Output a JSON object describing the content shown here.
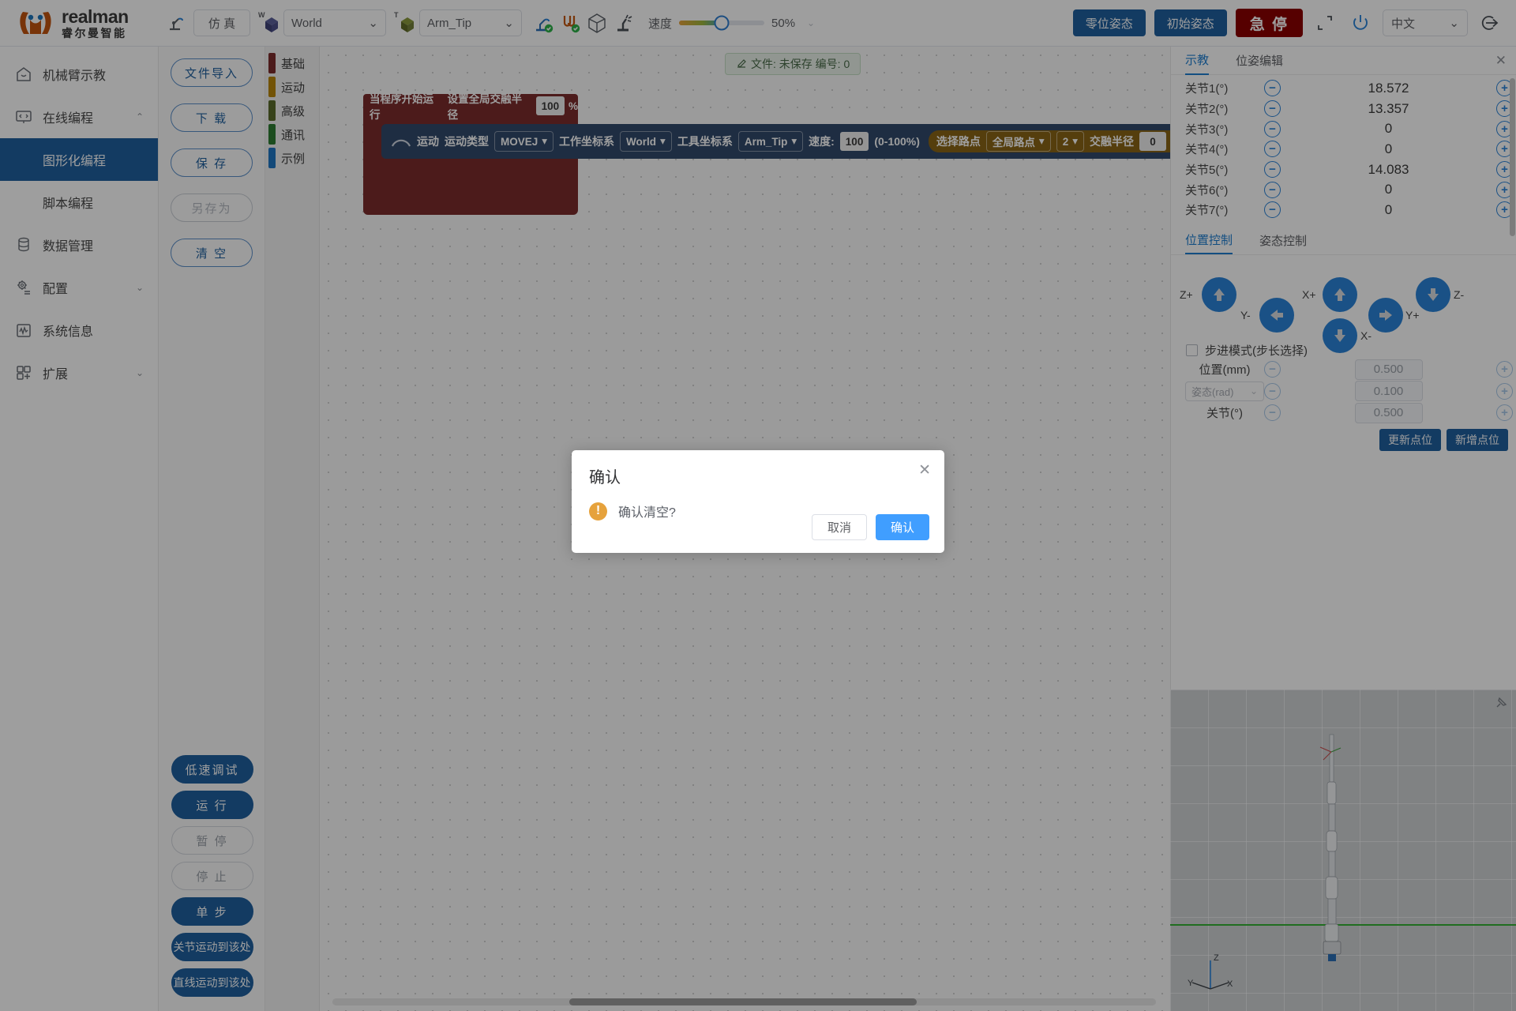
{
  "brand": {
    "en": "realman",
    "cn": "睿尔曼智能"
  },
  "topbar": {
    "robot_icon": "robot-arm-icon",
    "sim_button": "仿 真",
    "work_frame": {
      "prefix": "W",
      "value": "World"
    },
    "tool_frame": {
      "prefix": "T",
      "value": "Arm_Tip"
    },
    "icons": [
      "robot-connect-icon",
      "cable-connect-icon",
      "cube-icon",
      "collision-icon"
    ],
    "speed_label": "速度",
    "speed_value": "50%",
    "speed_percent": 50,
    "zero_pose": "零位姿态",
    "init_pose": "初始姿态",
    "estop": "急 停",
    "fullscreen_icon": "fullscreen-icon",
    "power_icon": "power-icon",
    "language": "中文",
    "logout_icon": "logout-icon"
  },
  "sidebar": {
    "items": [
      {
        "label": "机械臂示教",
        "icon": "home-icon",
        "arrow": ""
      },
      {
        "label": "在线编程",
        "icon": "code-icon",
        "arrow": "⌃"
      },
      {
        "label": "数据管理",
        "icon": "database-icon",
        "arrow": ""
      },
      {
        "label": "配置",
        "icon": "gear-icon",
        "arrow": "⌄"
      },
      {
        "label": "系统信息",
        "icon": "chart-icon",
        "arrow": ""
      },
      {
        "label": "扩展",
        "icon": "grid-icon",
        "arrow": "⌄"
      }
    ],
    "sub_items": [
      {
        "label": "图形化编程",
        "active": true
      },
      {
        "label": "脚本编程",
        "active": false
      }
    ]
  },
  "filecol": {
    "top": [
      {
        "label": "文件导入",
        "state": "normal"
      },
      {
        "label": "下 载",
        "state": "normal"
      },
      {
        "label": "保 存",
        "state": "normal"
      },
      {
        "label": "另存为",
        "state": "disabled"
      },
      {
        "label": "清 空",
        "state": "normal"
      }
    ],
    "bottom": [
      {
        "label": "低速调试",
        "state": "solid"
      },
      {
        "label": "运 行",
        "state": "solid"
      },
      {
        "label": "暂 停",
        "state": "ghost"
      },
      {
        "label": "停 止",
        "state": "ghost"
      },
      {
        "label": "单 步",
        "state": "solid"
      },
      {
        "label": "关节运动到该处",
        "state": "solid-narrow"
      },
      {
        "label": "直线运动到该处",
        "state": "solid-narrow"
      }
    ]
  },
  "categories": [
    {
      "label": "基础",
      "color": "#7b2d2d"
    },
    {
      "label": "运动",
      "color": "#b8860b"
    },
    {
      "label": "高级",
      "color": "#5a6b2a"
    },
    {
      "label": "通讯",
      "color": "#2e7d32"
    },
    {
      "label": "示例",
      "color": "#1f77c4"
    }
  ],
  "canvas": {
    "file_chip": {
      "icon": "edit-icon",
      "text": "文件: 未保存  编号: 0"
    },
    "start_block": {
      "text_a": "当程序开始运行",
      "text_b": "设置全局交融半径",
      "value": "100",
      "unit": "%"
    },
    "motion_block": {
      "loop_icon": "arc-icon",
      "label": "运动",
      "type_label": "运动类型",
      "type_value": "MOVEJ",
      "work_frame_label": "工作坐标系",
      "work_frame_value": "World",
      "tool_frame_label": "工具坐标系",
      "tool_frame_value": "Arm_Tip",
      "speed_label": "速度:",
      "speed_value": "100",
      "speed_range": "(0-100%)",
      "point_btn": "选择路点",
      "point_scope": "全局路点",
      "point_index": "2",
      "blend_label": "交融半径",
      "blend_value": "0",
      "blend_unit": "%"
    }
  },
  "right_panel": {
    "tabs": [
      {
        "label": "示教",
        "active": true
      },
      {
        "label": "位姿编辑",
        "active": false
      }
    ],
    "close_icon": "close-icon",
    "joints": [
      {
        "name": "关节1(°)",
        "value": "18.572"
      },
      {
        "name": "关节2(°)",
        "value": "13.357"
      },
      {
        "name": "关节3(°)",
        "value": "0"
      },
      {
        "name": "关节4(°)",
        "value": "0"
      },
      {
        "name": "关节5(°)",
        "value": "14.083"
      },
      {
        "name": "关节6(°)",
        "value": "0"
      },
      {
        "name": "关节7(°)",
        "value": "0"
      }
    ],
    "control_tabs": [
      {
        "label": "位置控制",
        "active": true
      },
      {
        "label": "姿态控制",
        "active": false
      }
    ],
    "jog_labels": {
      "zp": "Z+",
      "zm": "Z-",
      "xp": "X+",
      "xm": "X-",
      "yp": "Y+",
      "ym": "Y-"
    },
    "step_mode_label": "步进模式(步长选择)",
    "step_rows": [
      {
        "name": "位置(mm)",
        "value": "0.500",
        "is_select": false
      },
      {
        "name": "姿态(rad)",
        "value": "0.100",
        "is_select": true
      },
      {
        "name": "关节(°)",
        "value": "0.500",
        "is_select": false
      }
    ],
    "point_buttons": [
      {
        "label": "更新点位"
      },
      {
        "label": "新增点位"
      }
    ]
  },
  "view3d": {
    "pin_icon": "pin-icon",
    "axis_z": "Z",
    "axis_y": "Y",
    "axis_x": "X"
  },
  "modal": {
    "title": "确认",
    "close_icon": "close-icon",
    "warn_icon": "warning-icon",
    "message": "确认清空?",
    "cancel": "取消",
    "confirm": "确认"
  },
  "colors": {
    "brand_orange": "#c25410",
    "primary_blue": "#1f5f9e",
    "accent_blue": "#409eff",
    "danger_red": "#8b0000",
    "warn_orange": "#e6a23c"
  }
}
